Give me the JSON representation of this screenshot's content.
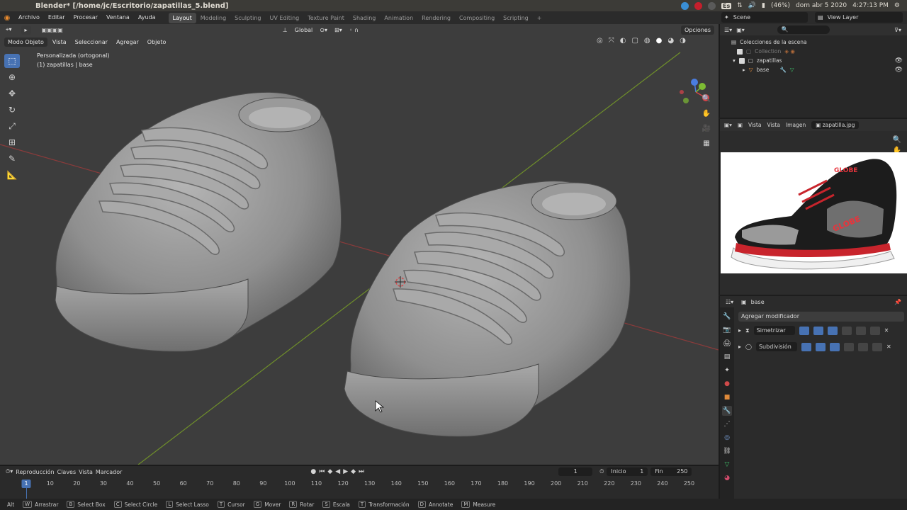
{
  "os": {
    "title": "Blender* [/home/jc/Escritorio/zapatillas_5.blend]",
    "battery": "(46%)",
    "keyboard": "Es",
    "date": "dom abr  5 2020",
    "time": "4:27:13 PM"
  },
  "menubar": {
    "items": [
      "Archivo",
      "Editar",
      "Procesar",
      "Ventana",
      "Ayuda"
    ],
    "workspaces": [
      "Layout",
      "Modeling",
      "Sculpting",
      "UV Editing",
      "Texture Paint",
      "Shading",
      "Animation",
      "Rendering",
      "Compositing",
      "Scripting"
    ],
    "add_workspace": "+",
    "scene": "Scene",
    "view_layer": "View Layer"
  },
  "viewport": {
    "orientation": "Global",
    "options": "Opciones",
    "mode": "Modo Objeto",
    "menus": [
      "Vista",
      "Seleccionar",
      "Agregar",
      "Objeto"
    ],
    "view_name": "Personalizada (ortogonal)",
    "object_info": "(1) zapatillas | base"
  },
  "outliner": {
    "search": "",
    "root": "Colecciones de la escena",
    "collection": "Collection",
    "child_collection": "zapatillas",
    "object": "base"
  },
  "image_editor": {
    "menus": [
      "Vista",
      "Vista",
      "Imagen"
    ],
    "image_name": "zapatilla.jpg",
    "brand": "GLOBE"
  },
  "properties": {
    "object": "base",
    "add_modifier": "Agregar modificador",
    "modifiers": [
      "Simetrizar",
      "Subdivisión"
    ]
  },
  "timeline": {
    "menus": [
      "Reproducción",
      "Claves",
      "Vista",
      "Marcador"
    ],
    "current_frame": "1",
    "start_label": "Inicio",
    "start": "1",
    "end_label": "Fin",
    "end": "250",
    "ticks": [
      "10",
      "20",
      "30",
      "40",
      "50",
      "60",
      "70",
      "80",
      "90",
      "100",
      "110",
      "120",
      "130",
      "140",
      "150",
      "160",
      "170",
      "180",
      "190",
      "200",
      "210",
      "220",
      "230",
      "240",
      "250"
    ]
  },
  "statusbar": {
    "modifier": "Alt",
    "items": [
      {
        "key": "W",
        "label": "Arrastrar"
      },
      {
        "key": "B",
        "label": "Select Box"
      },
      {
        "key": "C",
        "label": "Select Circle"
      },
      {
        "key": "L",
        "label": "Select Lasso"
      },
      {
        "key": "T",
        "label": "Cursor"
      },
      {
        "key": "G",
        "label": "Mover"
      },
      {
        "key": "R",
        "label": "Rotar"
      },
      {
        "key": "S",
        "label": "Escala"
      },
      {
        "key": "T",
        "label": "Transformación"
      },
      {
        "key": "D",
        "label": "Annotate"
      },
      {
        "key": "M",
        "label": "Measure"
      }
    ]
  },
  "colors": {
    "accent": "#4772b3",
    "viewport_bg": "#3d3d3d",
    "x_axis": "#a33a3a",
    "y_axis": "#7a9a2a"
  }
}
